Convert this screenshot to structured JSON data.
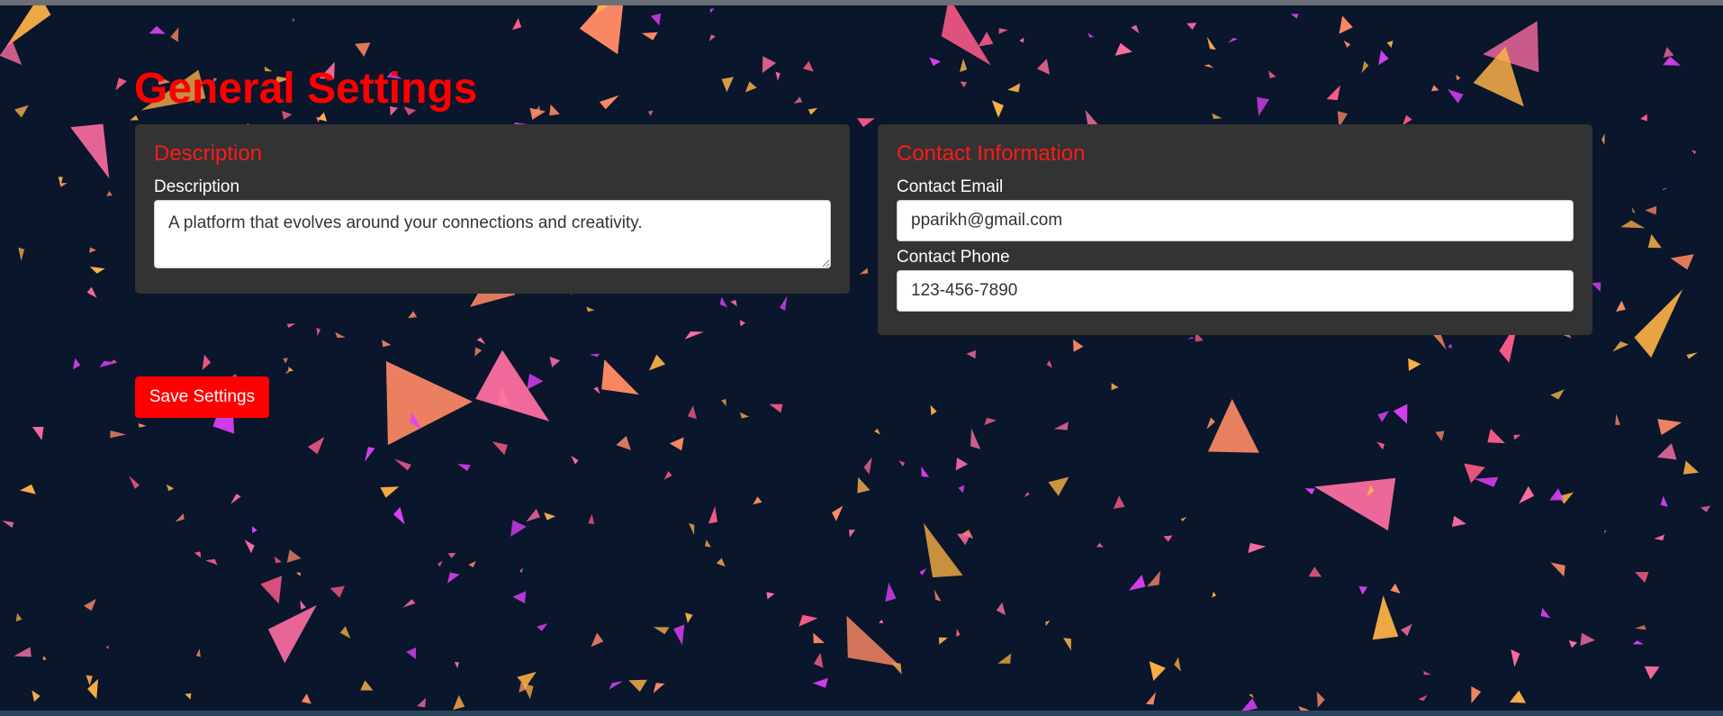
{
  "page": {
    "title": "General Settings"
  },
  "description_card": {
    "heading": "Description",
    "field_label": "Description",
    "field_value": "A platform that evolves around your connections and creativity."
  },
  "contact_card": {
    "heading": "Contact Information",
    "email_label": "Contact Email",
    "email_value": "pparikh@gmail.com",
    "phone_label": "Contact Phone",
    "phone_value": "123-456-7890"
  },
  "actions": {
    "save_label": "Save Settings"
  },
  "theme": {
    "accent": "#ff0000",
    "background": "#0a162b",
    "card_background": "#333333",
    "confetti_colors": [
      "#ff6fa3",
      "#ff8a65",
      "#ffb347",
      "#e040fb",
      "#ff5c8a"
    ]
  }
}
